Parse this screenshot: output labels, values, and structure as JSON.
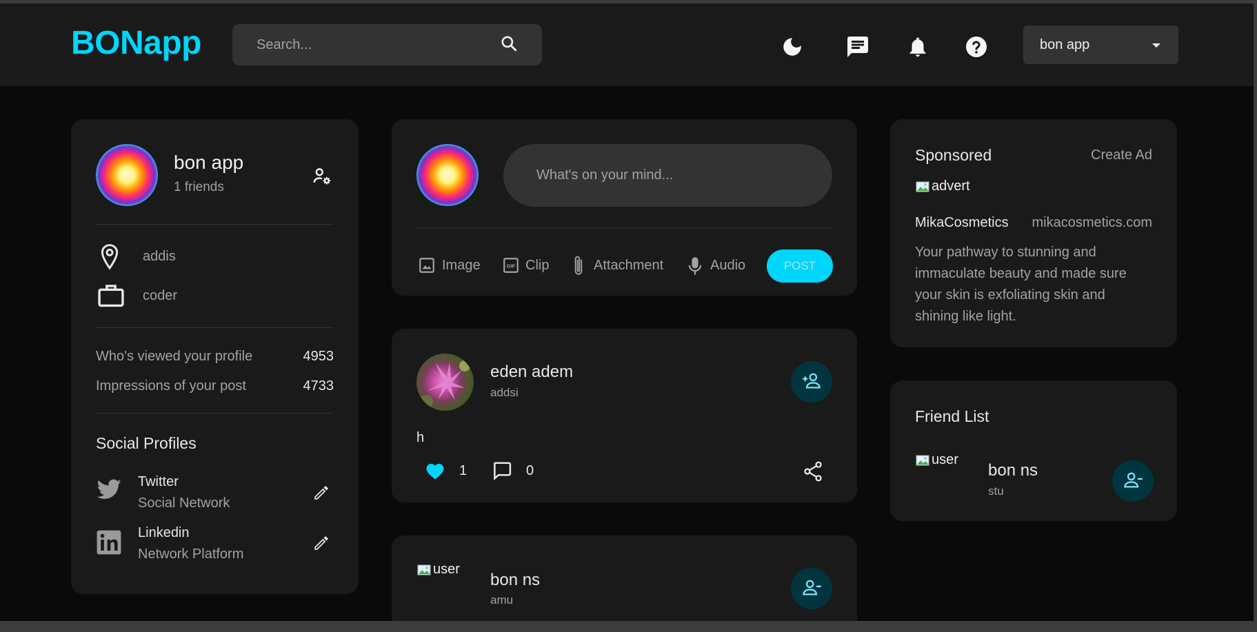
{
  "app": {
    "brand": "BONapp"
  },
  "search": {
    "placeholder": "Search..."
  },
  "header": {
    "user_name": "bon app"
  },
  "profile": {
    "name": "bon app",
    "friends": "1 friends",
    "location": "addis",
    "occupation": "coder",
    "stats": [
      {
        "label": "Who's viewed your profile",
        "value": "4953"
      },
      {
        "label": "Impressions of your post",
        "value": "4733"
      }
    ],
    "social_title": "Social Profiles",
    "socials": [
      {
        "name": "Twitter",
        "type": "Social Network"
      },
      {
        "name": "Linkedin",
        "type": "Network Platform"
      }
    ]
  },
  "composer": {
    "placeholder": "What's on your mind...",
    "actions": [
      "Image",
      "Clip",
      "Attachment",
      "Audio"
    ],
    "post_label": "POST"
  },
  "posts": [
    {
      "name": "eden adem",
      "location": "addsi",
      "text": "h",
      "likes": "1",
      "comments": "0"
    },
    {
      "name": "bon ns",
      "location": "amu",
      "img_alt": "user"
    }
  ],
  "sponsored": {
    "title": "Sponsored",
    "create_label": "Create Ad",
    "img_alt": "advert",
    "brand": "MikaCosmetics",
    "site": "mikacosmetics.com",
    "text": "Your pathway to stunning and immaculate beauty and made sure your skin is exfoliating skin and shining like light."
  },
  "friend_list": {
    "title": "Friend List",
    "friends": [
      {
        "name": "bon ns",
        "location": "stu",
        "img_alt": "user"
      }
    ]
  },
  "colors": {
    "accent": "#00d5fa",
    "card": "#1a1a1a",
    "bg": "#0a0a0a",
    "input": "#333333"
  }
}
